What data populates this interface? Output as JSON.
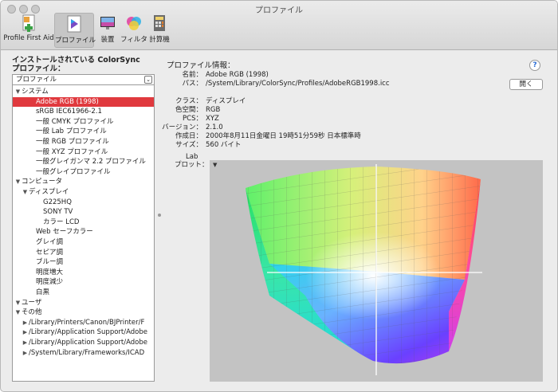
{
  "window": {
    "title": "プロファイル"
  },
  "toolbar": {
    "items": [
      {
        "label": "Profile First Aid",
        "icon": "first-aid-icon"
      },
      {
        "label": "プロファイル",
        "icon": "profile-icon"
      },
      {
        "label": "装置",
        "icon": "display-icon"
      },
      {
        "label": "フィルタ",
        "icon": "filter-icon"
      },
      {
        "label": "計算機",
        "icon": "calculator-icon"
      }
    ],
    "selected": "プロファイル"
  },
  "left": {
    "title_line1": "インストールされている ColorSync",
    "title_line2": "プロファイル：",
    "select_value": "プロファイル",
    "tree": [
      {
        "label": "システム",
        "indent": 0,
        "toggle": "open"
      },
      {
        "label": "Adobe RGB (1998)",
        "indent": 2,
        "selected": true
      },
      {
        "label": "sRGB IEC61966-2.1",
        "indent": 2
      },
      {
        "label": "一般 CMYK プロファイル",
        "indent": 2
      },
      {
        "label": "一般 Lab プロファイル",
        "indent": 2
      },
      {
        "label": "一般 RGB プロファイル",
        "indent": 2
      },
      {
        "label": "一般 XYZ プロファイル",
        "indent": 2
      },
      {
        "label": "一般グレイガンマ 2.2 プロファイル",
        "indent": 2
      },
      {
        "label": "一般グレイプロファイル",
        "indent": 2
      },
      {
        "label": "コンピュータ",
        "indent": 0,
        "toggle": "open"
      },
      {
        "label": "ディスプレイ",
        "indent": 1,
        "toggle": "open"
      },
      {
        "label": "G225HQ",
        "indent": 3
      },
      {
        "label": "SONY TV",
        "indent": 3
      },
      {
        "label": "カラー LCD",
        "indent": 3
      },
      {
        "label": "Web セーフカラー",
        "indent": 2
      },
      {
        "label": "グレイ調",
        "indent": 2
      },
      {
        "label": "セピア調",
        "indent": 2
      },
      {
        "label": "ブルー調",
        "indent": 2
      },
      {
        "label": "明度増大",
        "indent": 2
      },
      {
        "label": "明度減少",
        "indent": 2
      },
      {
        "label": "白黒",
        "indent": 2
      },
      {
        "label": "ユーザ",
        "indent": 0,
        "toggle": "open"
      },
      {
        "label": "その他",
        "indent": 0,
        "toggle": "open"
      },
      {
        "label": "/Library/Printers/Canon/BJPrinter/F",
        "indent": 1,
        "toggle": "closed"
      },
      {
        "label": "/Library/Application Support/Adobe",
        "indent": 1,
        "toggle": "closed"
      },
      {
        "label": "/Library/Application Support/Adobe",
        "indent": 1,
        "toggle": "closed"
      },
      {
        "label": "/System/Library/Frameworks/ICAD",
        "indent": 1,
        "toggle": "closed"
      }
    ]
  },
  "info": {
    "title": "プロファイル情報：",
    "help": "?",
    "open_button": "開く",
    "fields": [
      {
        "key": "名前：",
        "value": "Adobe RGB (1998)"
      },
      {
        "key": "パス：",
        "value": "/System/Library/ColorSync/Profiles/AdobeRGB1998.icc"
      },
      {
        "key": "クラス：",
        "value": "ディスプレイ"
      },
      {
        "key": "色空間：",
        "value": "RGB"
      },
      {
        "key": "PCS：",
        "value": "XYZ"
      },
      {
        "key": "バージョン：",
        "value": "2.1.0"
      },
      {
        "key": "作成日：",
        "value": "2000年8月11日金曜日 19時51分59秒 日本標準時"
      },
      {
        "key": "サイズ：",
        "value": "560 バイト"
      }
    ],
    "plot_label_line1": "Lab",
    "plot_label_line2": "プロット："
  },
  "colors": {
    "selection": "#e0393e",
    "plot_bg": "#c3c3c3"
  }
}
